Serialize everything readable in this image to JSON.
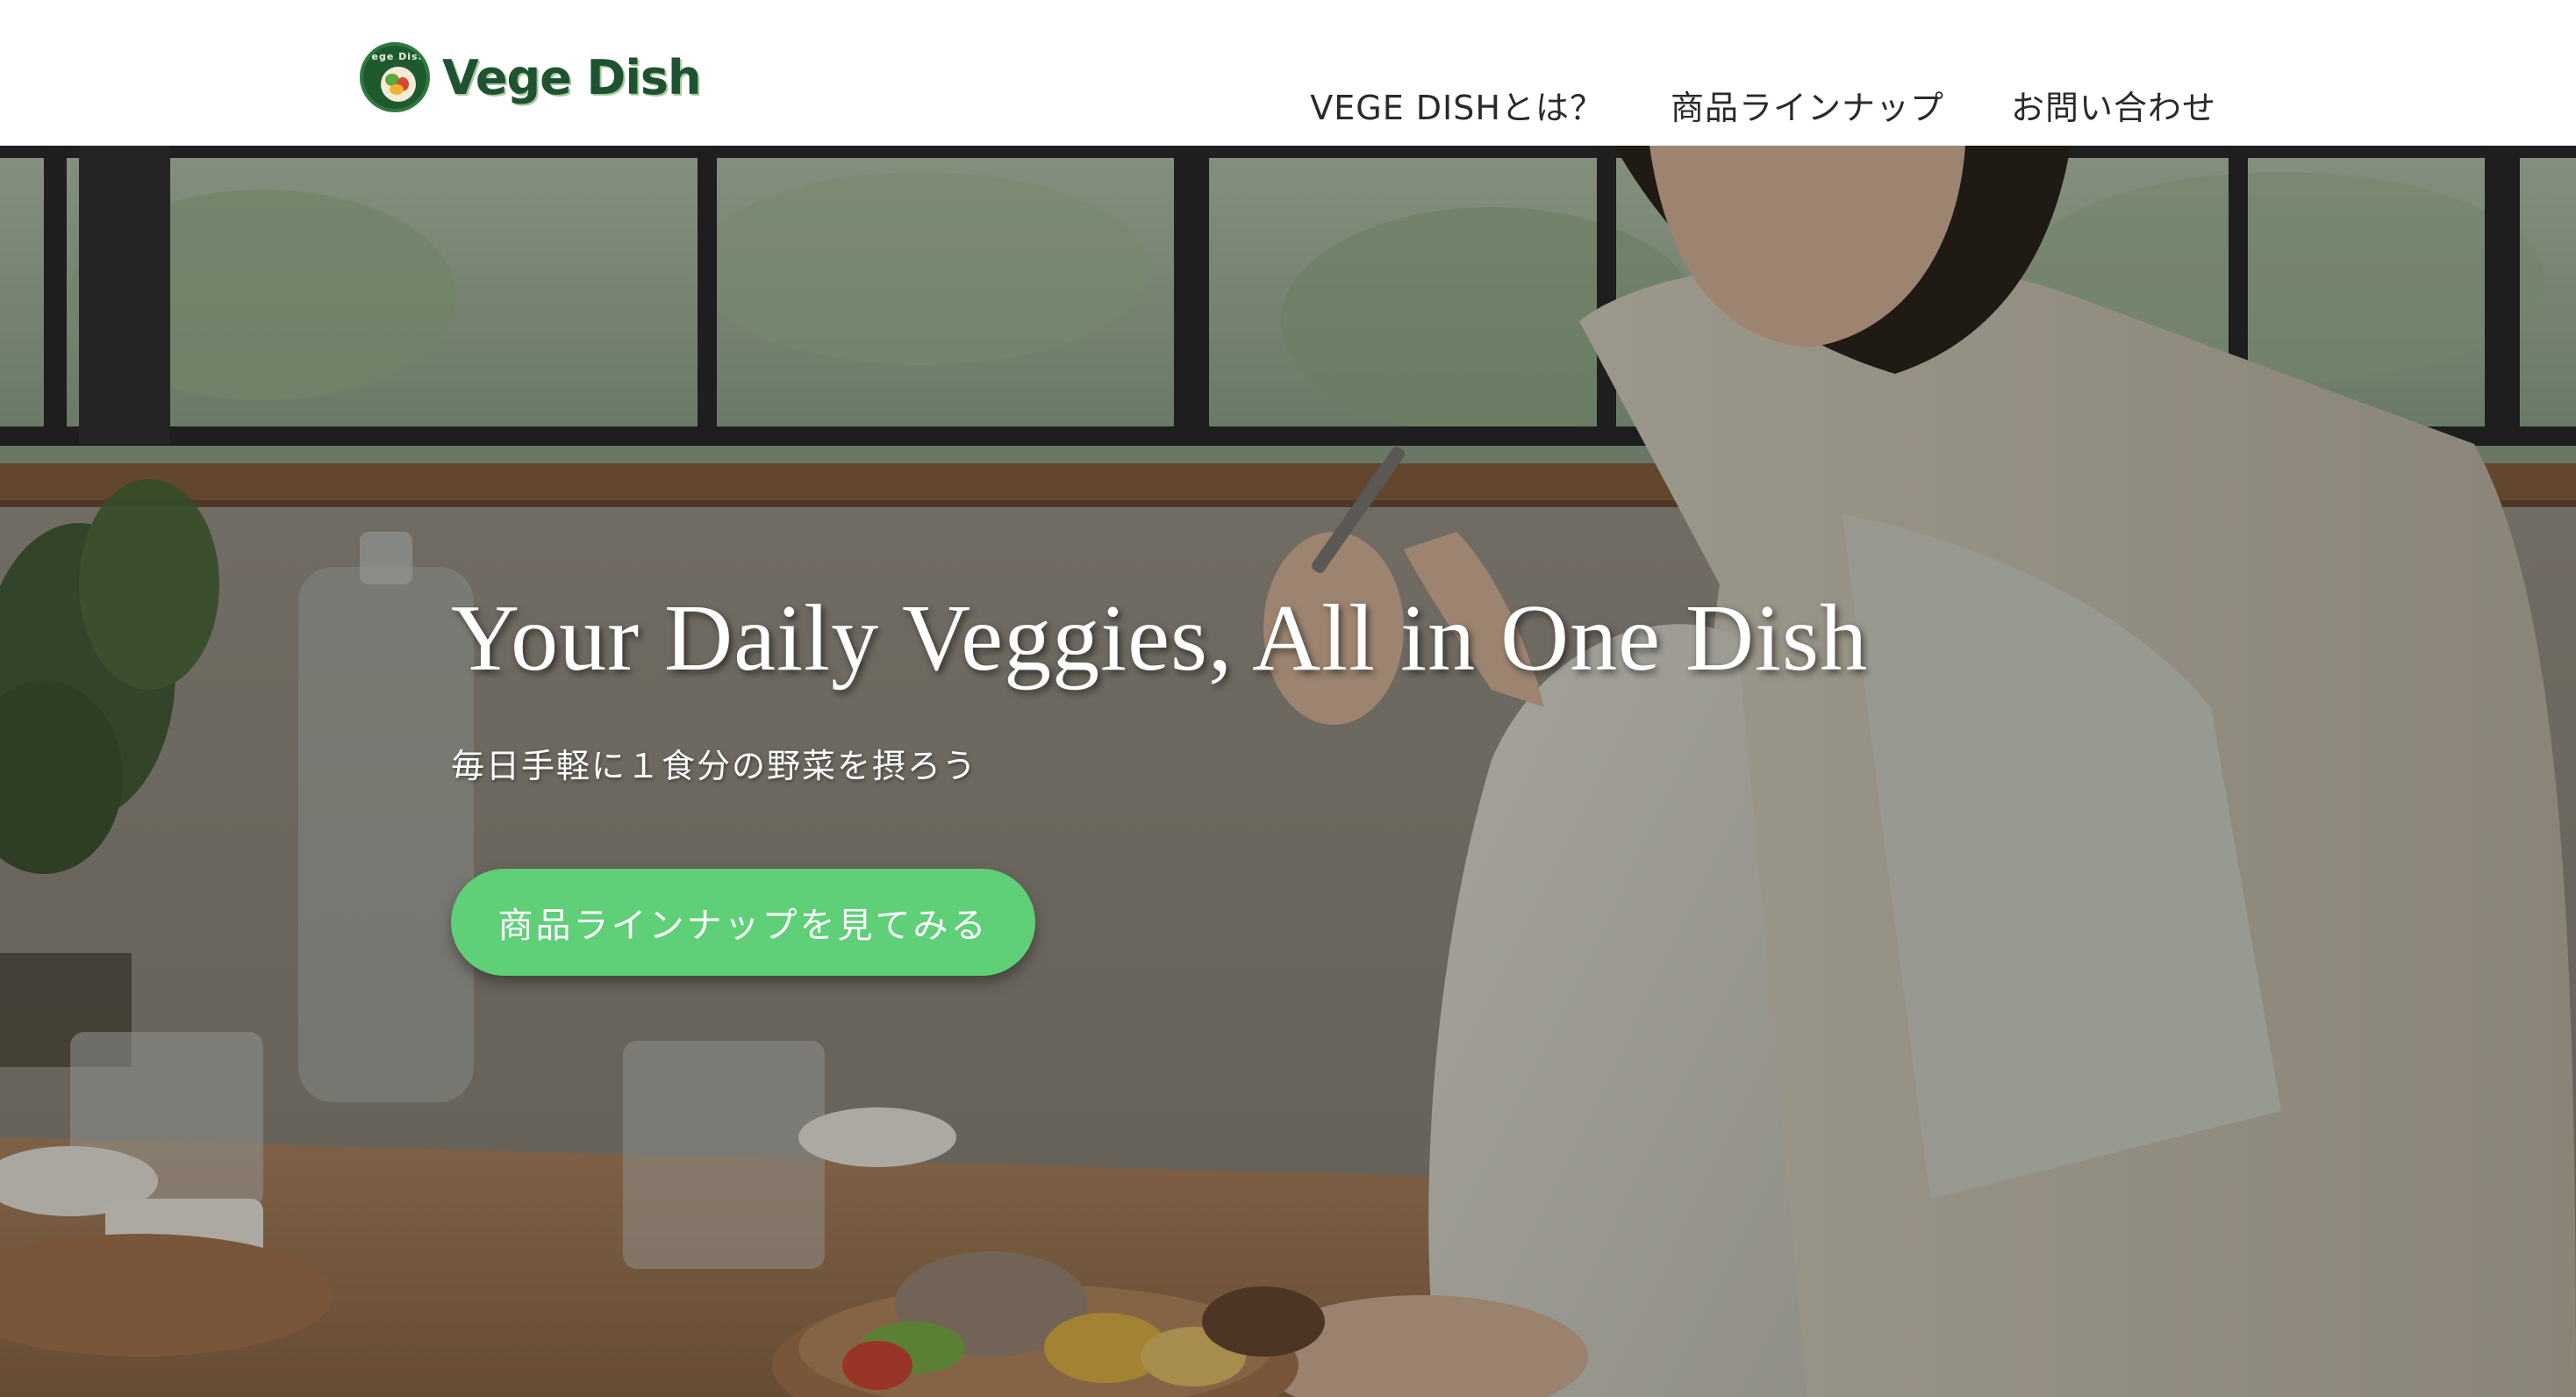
{
  "header": {
    "logo": {
      "text": "Vege Dish",
      "badge_text": "Vege Dish"
    },
    "nav": {
      "items": [
        {
          "label": "VEGE DISHとは？"
        },
        {
          "label": "商品ラインナップ"
        },
        {
          "label": "お問い合わせ"
        }
      ]
    }
  },
  "hero": {
    "title": "Your Daily Veggies, All in One Dish",
    "subtitle": "毎日手軽に１食分の野菜を摂ろう",
    "cta_label": "商品ラインナップを見てみる"
  },
  "colors": {
    "brand_green": "#1e5230",
    "cta_green": "#5fcf78",
    "nav_text": "#2a2a2a"
  },
  "icons": {
    "logo_badge": "salad-bowl-icon"
  }
}
